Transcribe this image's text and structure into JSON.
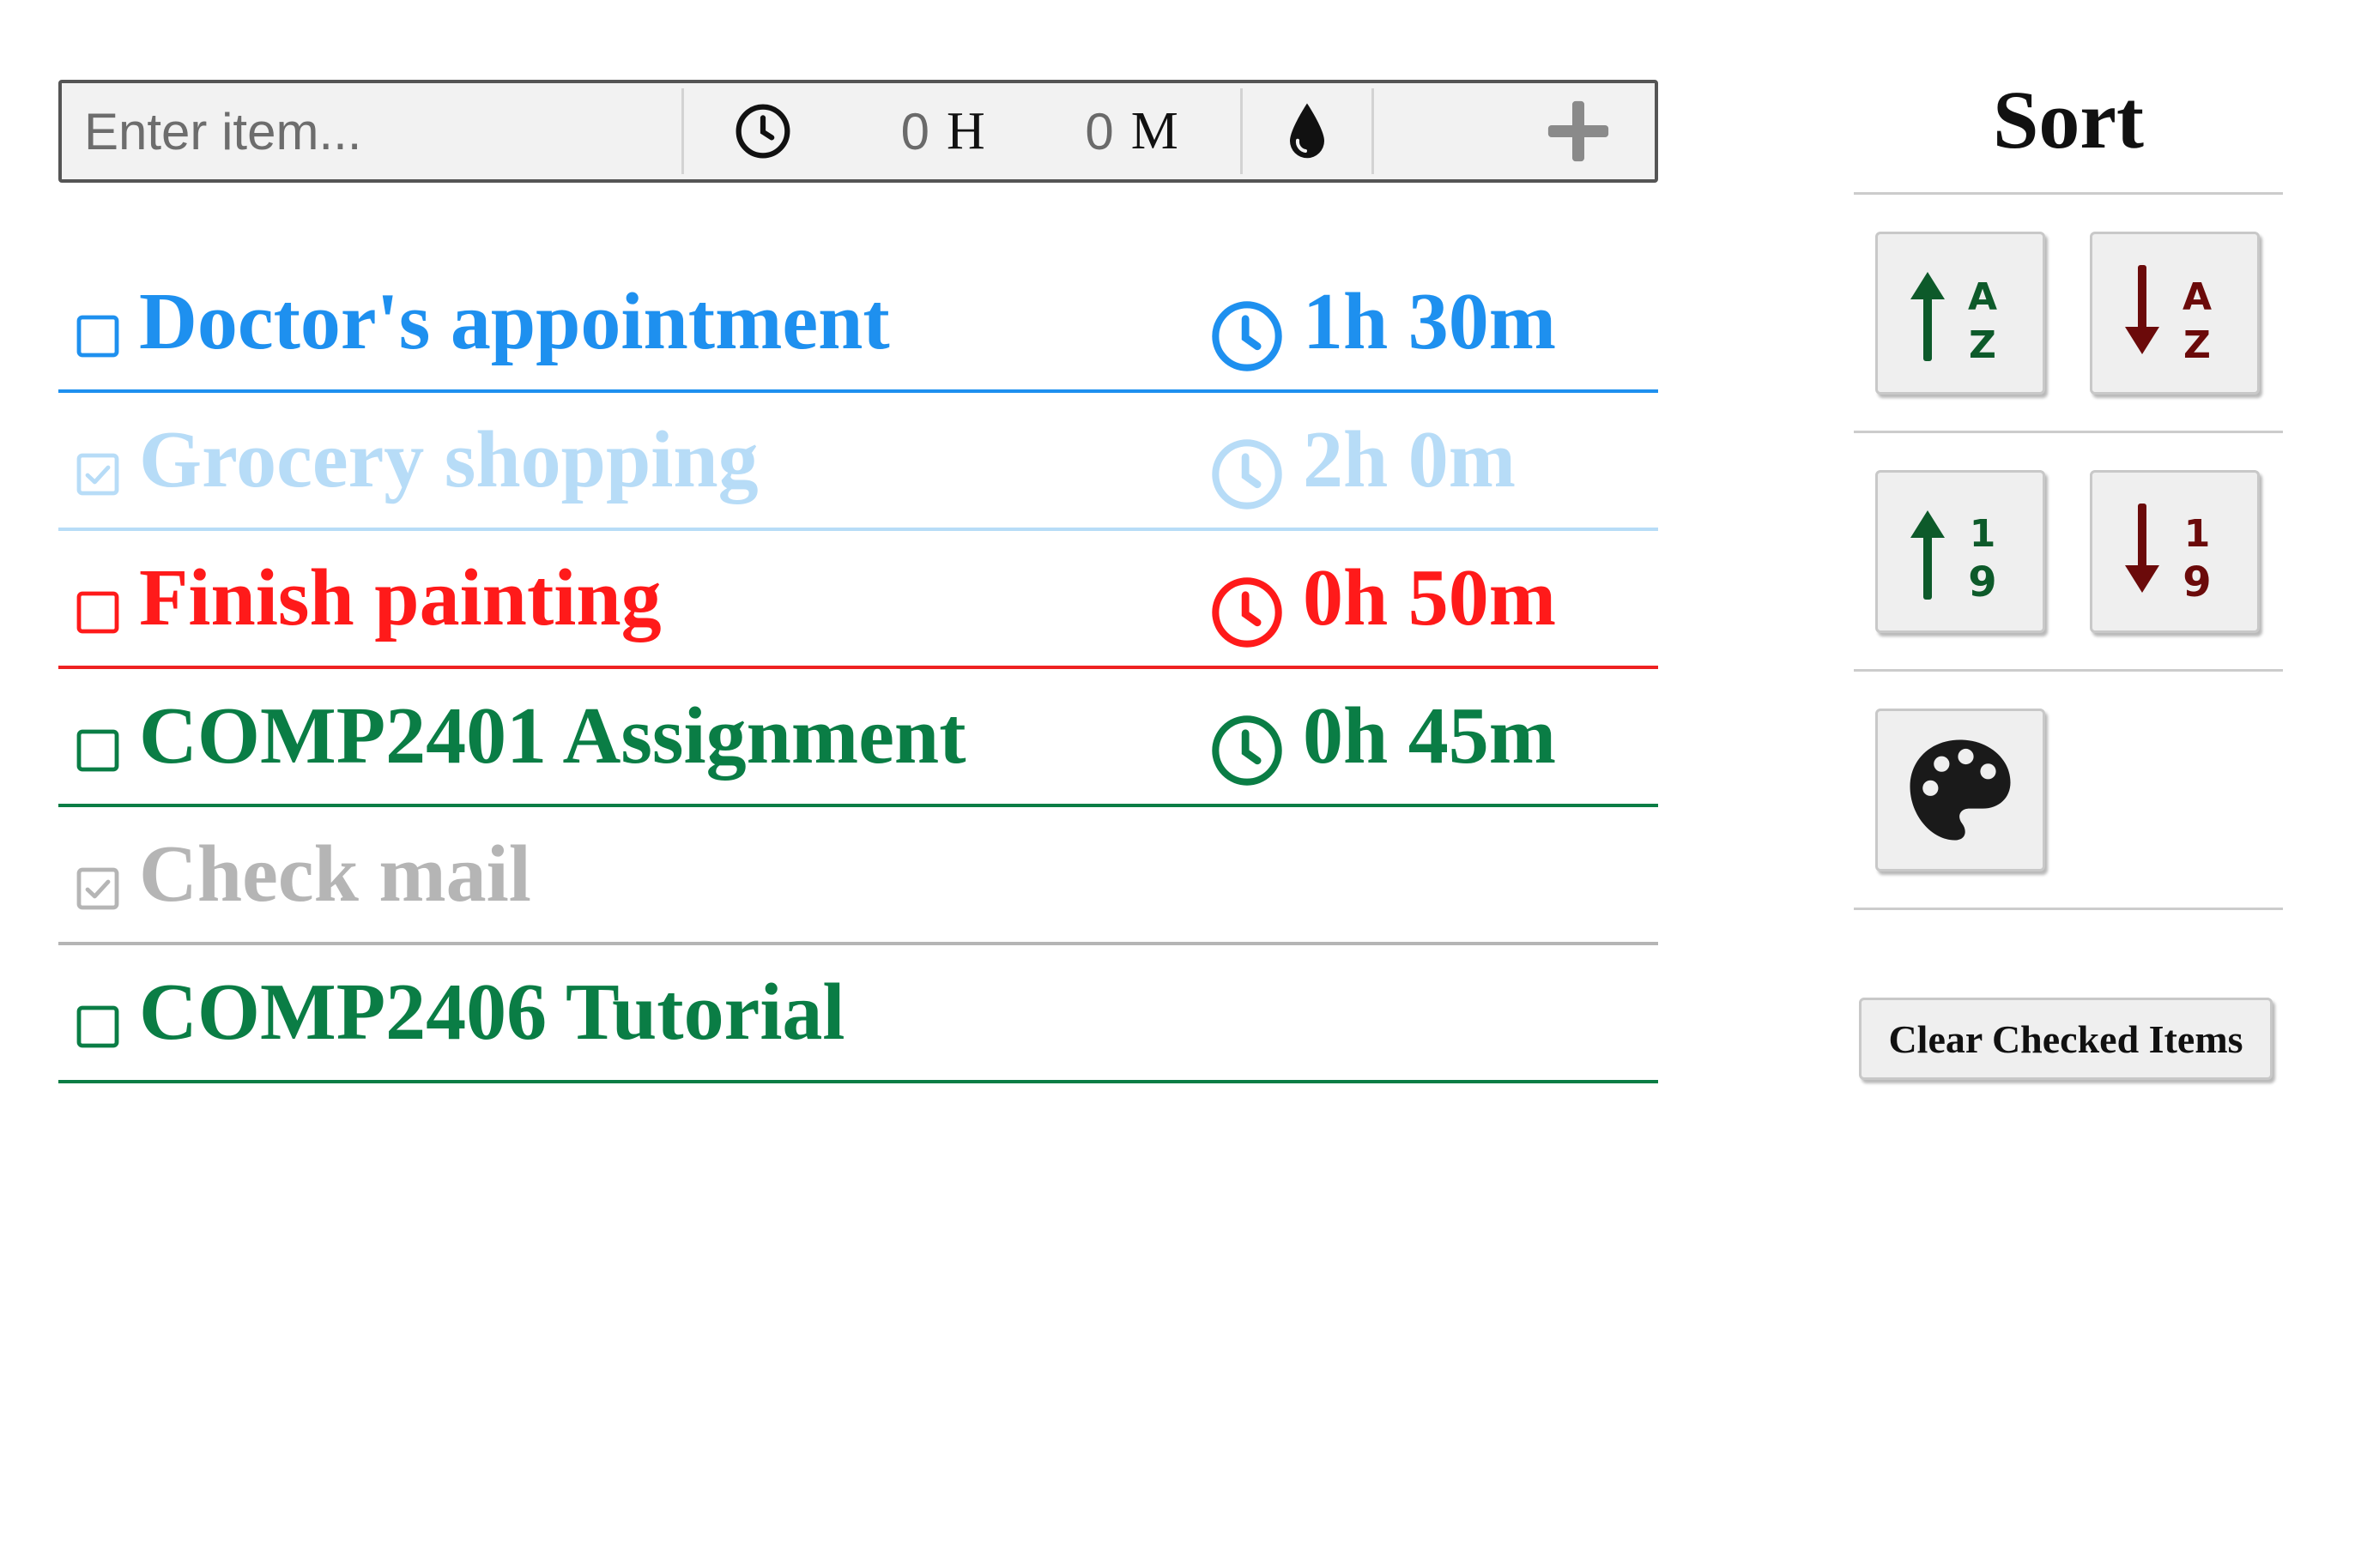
{
  "input_bar": {
    "item_placeholder": "Enter item...",
    "hours_value": "0",
    "hours_unit": "H",
    "minutes_value": "0",
    "minutes_unit": "M",
    "icons": [
      "clock-icon",
      "droplet-icon",
      "plus-icon"
    ]
  },
  "todos": [
    {
      "label": "Doctor's appointment",
      "duration": "1h 30m",
      "checked": false,
      "color": "#1e90ef",
      "line": "#1e90ef"
    },
    {
      "label": "Grocery shopping",
      "duration": "2h 0m",
      "checked": true,
      "color": "#b7dcf7",
      "line": "#b7dcf7"
    },
    {
      "label": "Finish painting",
      "duration": "0h 50m",
      "checked": false,
      "color": "#ff1a1a",
      "line": "#ee2222"
    },
    {
      "label": "COMP2401 Assignment",
      "duration": "0h 45m",
      "checked": false,
      "color": "#0a7d45",
      "line": "#0a7d45"
    },
    {
      "label": "Check mail",
      "duration": "",
      "checked": true,
      "color": "#b5b5b5",
      "line": "#b5b5b5"
    },
    {
      "label": "COMP2406 Tutorial",
      "duration": "",
      "checked": false,
      "color": "#0a7d45",
      "line": "#0a7d45"
    }
  ],
  "sidebar": {
    "title": "Sort",
    "sort_buttons": [
      "sort-alpha-asc-icon",
      "sort-alpha-desc-icon",
      "sort-numeric-asc-icon",
      "sort-numeric-desc-icon",
      "palette-icon"
    ],
    "clear_label": "Clear Checked Items"
  },
  "colors": {
    "asc": "#0d5a2a",
    "desc": "#6b0a0a",
    "icon_dark": "#111111",
    "plus": "#8a8a8a"
  }
}
